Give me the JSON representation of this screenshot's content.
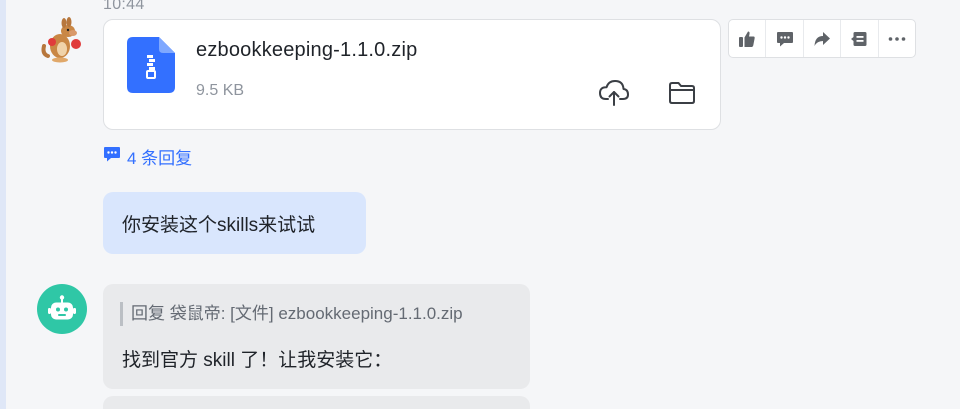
{
  "message1": {
    "timestamp": "10:44",
    "sender_avatar_icon": "kangaroo-avatar-icon",
    "file": {
      "name": "ezbookkeeping-1.1.0.zip",
      "size": "9.5 KB",
      "file_type_icon": "zip-file-icon",
      "actions": [
        {
          "icon": "cloud-upload-icon"
        },
        {
          "icon": "folder-icon"
        }
      ]
    },
    "toolbar": [
      {
        "icon": "thumbs-up-icon"
      },
      {
        "icon": "comment-icon"
      },
      {
        "icon": "forward-icon"
      },
      {
        "icon": "reply-icon"
      },
      {
        "icon": "more-icon"
      }
    ],
    "replies_link": "4 条回复"
  },
  "message2": {
    "text": "你安装这个skills来试试"
  },
  "message3": {
    "sender_avatar_icon": "robot-avatar-icon",
    "quote": "回复 袋鼠帝: [文件] ezbookkeeping-1.1.0.zip",
    "text": "找到官方 skill 了！让我安装它："
  },
  "colors": {
    "accent": "#3370ff",
    "user_bubble": "#d9e6fd",
    "bot_bubble": "#e9eaec",
    "bot_avatar": "#2fc7a6",
    "file_icon": "#3370ff"
  }
}
